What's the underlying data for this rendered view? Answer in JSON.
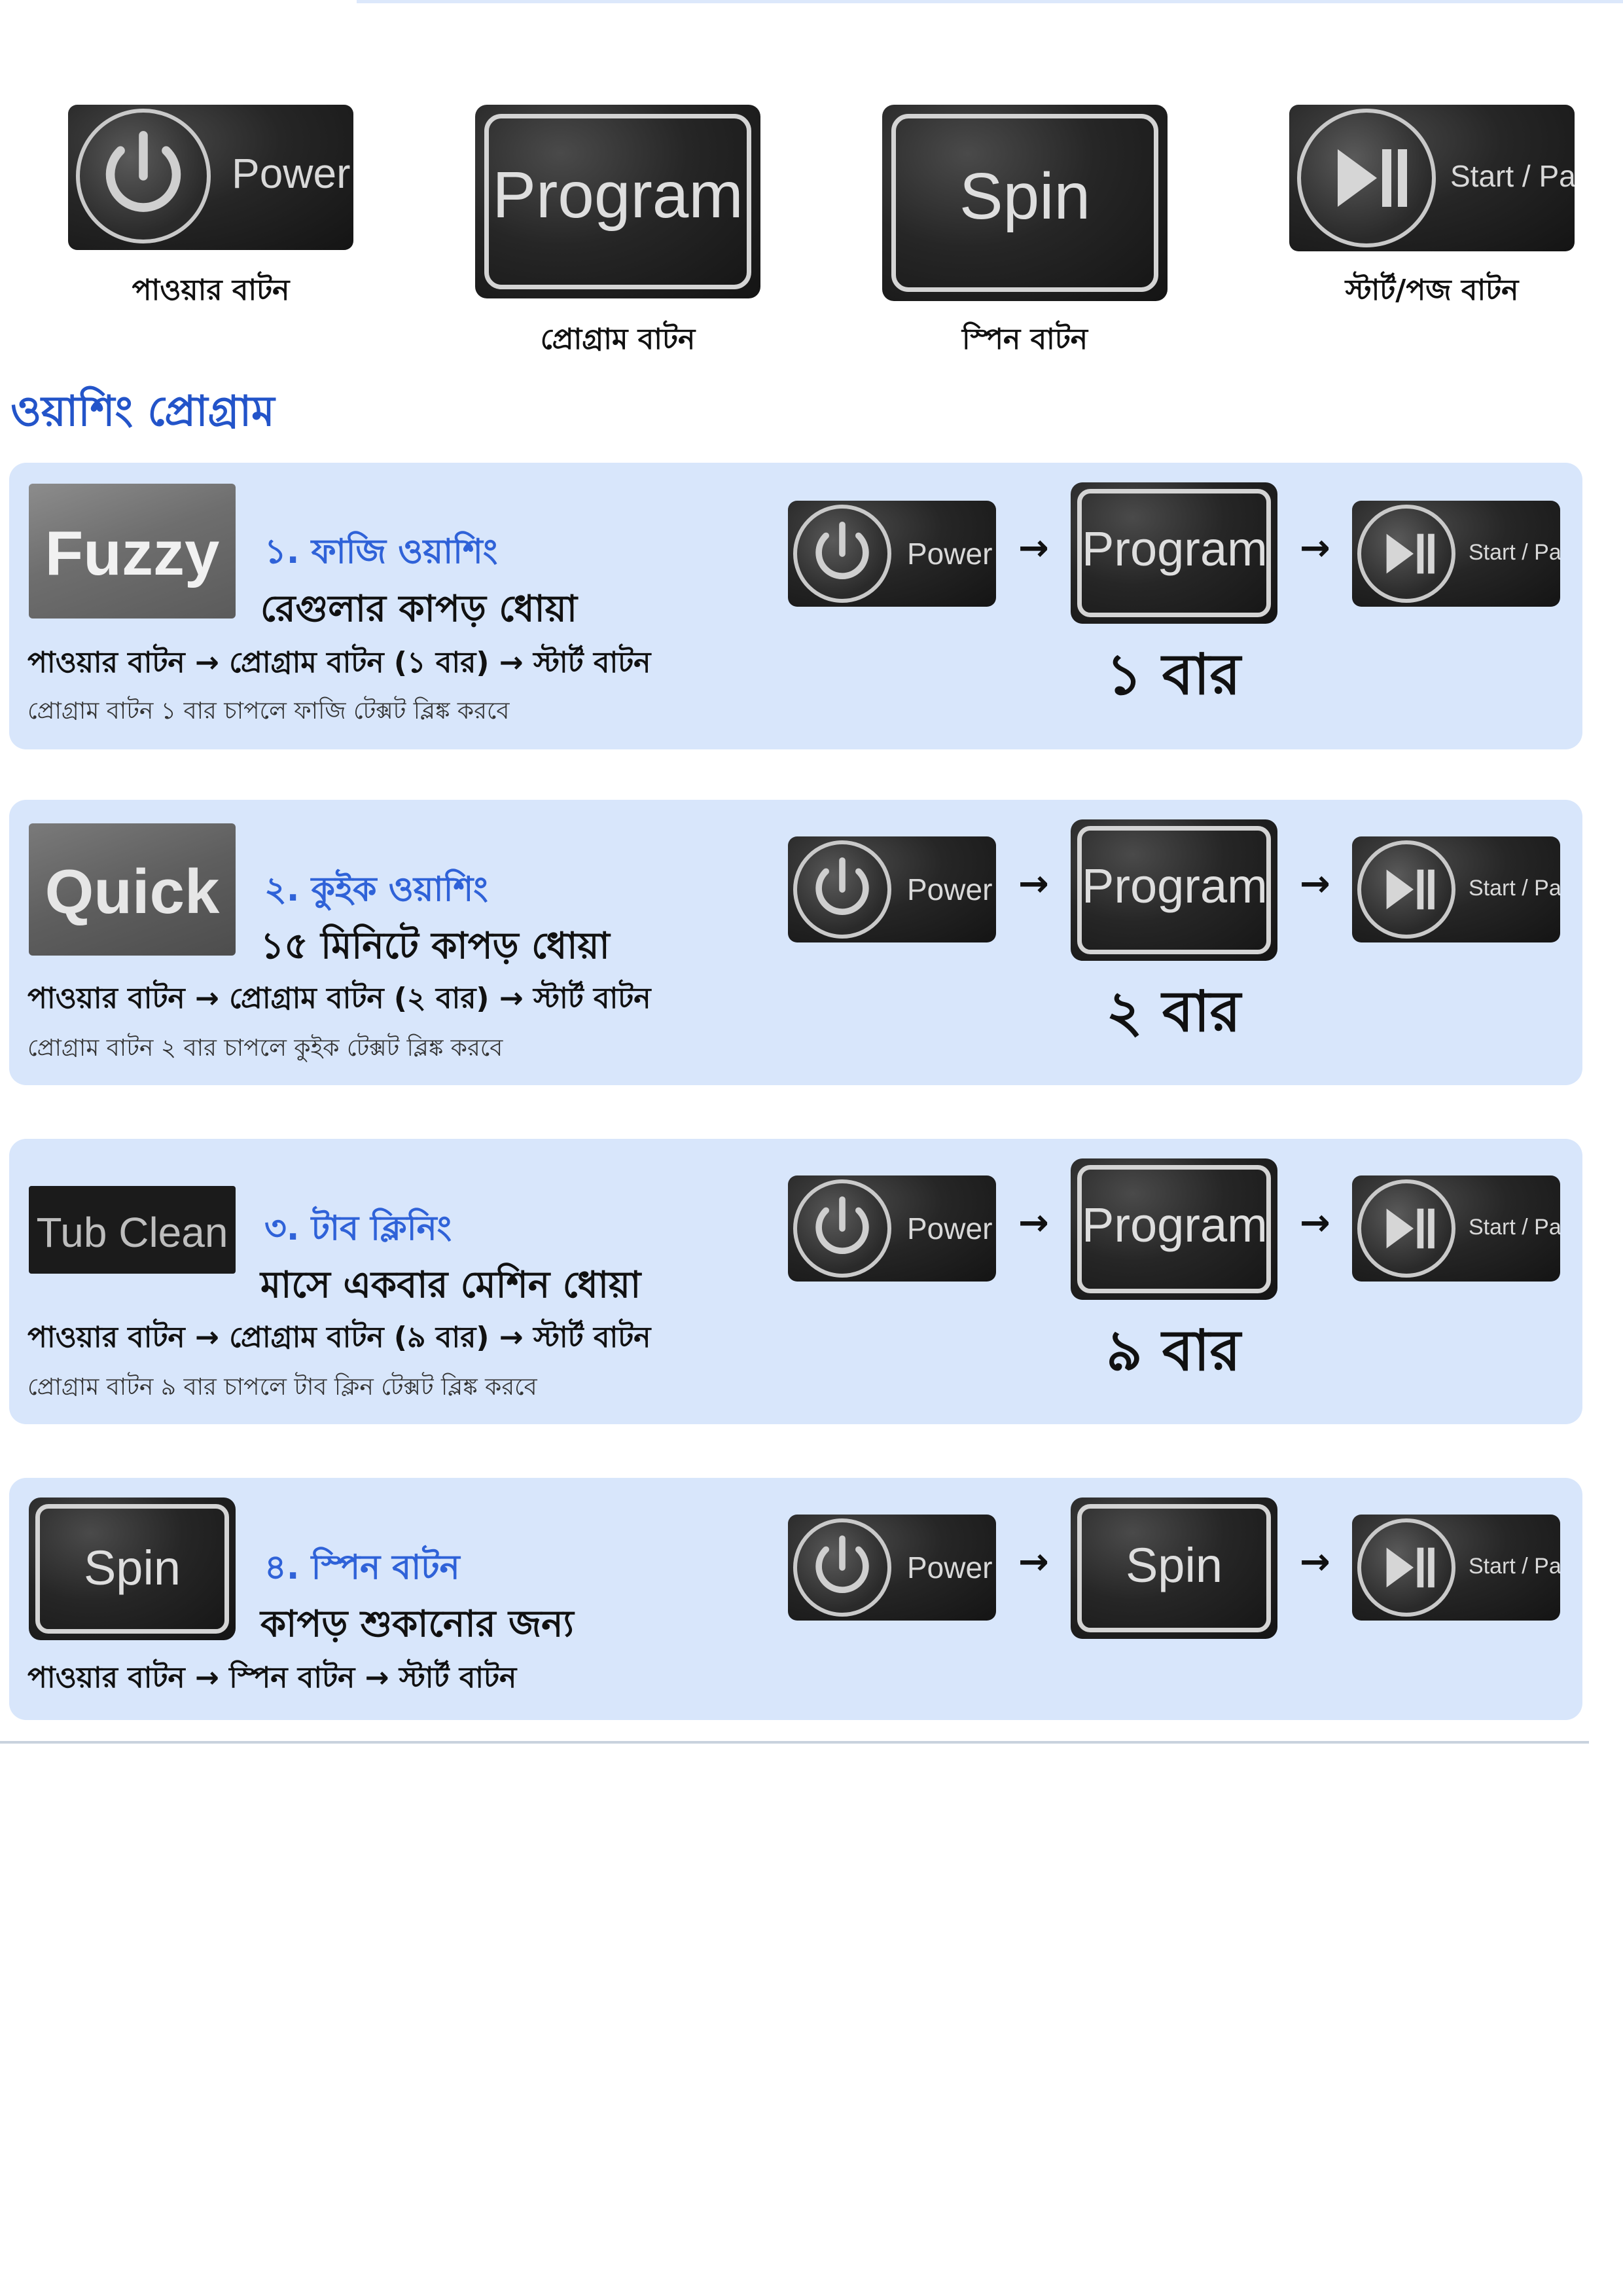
{
  "legend": {
    "power": {
      "tile_text": "Power",
      "caption": "পাওয়ার বাটন"
    },
    "program": {
      "tile_text": "Program",
      "caption": "প্রোগ্রাম বাটন"
    },
    "spin": {
      "tile_text": "Spin",
      "caption": "স্পিন বাটন"
    },
    "start": {
      "tile_text": "Start / Pa",
      "caption": "স্টার্ট/পজ বাটন"
    }
  },
  "section_title": "ওয়াশিং প্রোগ্রাম",
  "buttons": {
    "power_text": "Power",
    "program_text": "Program",
    "spin_text": "Spin",
    "start_text": "Start / Pa",
    "arrow": "→"
  },
  "programs": [
    {
      "label_image_text": "Fuzzy",
      "title": "১. ফাজি ওয়াশিং",
      "subtitle": "রেগুলার কাপড় ধোয়া",
      "steps": "পাওয়ার বাটন → প্রোগ্রাম বাটন (১ বার) → স্টার্ট বাটন",
      "note": "প্রোগ্রাম বাটন ১ বার চাপলে ফাজি টেক্সট ব্লিঙ্ক করবে",
      "press_count": "১ বার"
    },
    {
      "label_image_text": "Quick",
      "title": "২. কুইক ওয়াশিং",
      "subtitle": "১৫ মিনিটে কাপড় ধোয়া",
      "steps": "পাওয়ার বাটন → প্রোগ্রাম বাটন (২ বার) → স্টার্ট বাটন",
      "note": "প্রোগ্রাম বাটন ২ বার চাপলে কুইক টেক্সট ব্লিঙ্ক করবে",
      "press_count": "২ বার"
    },
    {
      "label_image_text": "Tub Clean",
      "title": "৩. টাব ক্লিনিং",
      "subtitle": "মাসে একবার মেশিন ধোয়া",
      "steps": "পাওয়ার বাটন → প্রোগ্রাম বাটন (৯ বার) → স্টার্ট বাটন",
      "note": "প্রোগ্রাম বাটন ৯ বার চাপলে টাব ক্লিন টেক্সট ব্লিঙ্ক করবে",
      "press_count": "৯ বার"
    },
    {
      "label_image_text": "Spin",
      "title": "৪. স্পিন বাটন",
      "subtitle": "কাপড় শুকানোর জন্য",
      "steps": "পাওয়ার বাটন → স্পিন বাটন → স্টার্ট বাটন"
    }
  ],
  "colors": {
    "accent_blue": "#2f62d8",
    "card_background": "#d8e6fb",
    "button_black": "#1b1b1b"
  }
}
